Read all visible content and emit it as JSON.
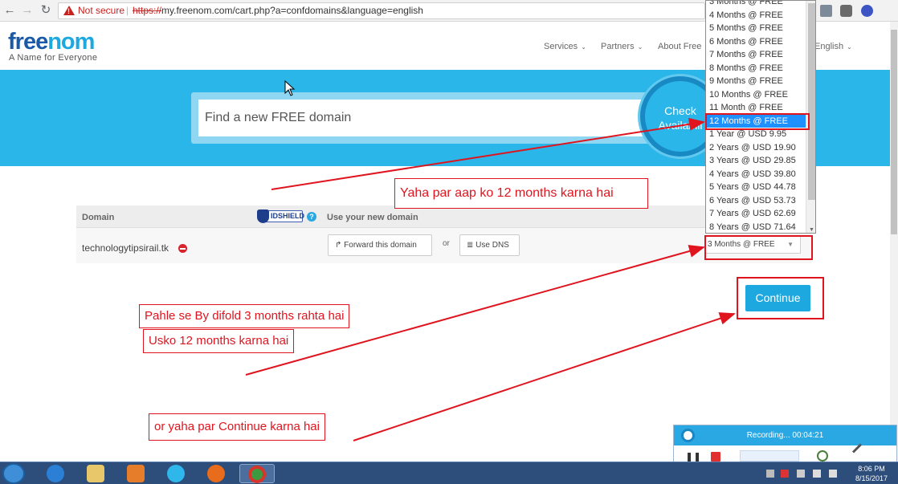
{
  "browser": {
    "back_glyph": "←",
    "forward_glyph": "→",
    "reload_glyph": "↻",
    "security_label": "Not secure",
    "url_separator": "|",
    "url_scheme": "https://",
    "url_rest": "my.freenom.com/cart.php?a=confdomains&language=english"
  },
  "site": {
    "logo_part1": "free",
    "logo_part2": "nom",
    "tagline": "A Name for Everyone",
    "nav": [
      "Services",
      "Partners",
      "About Free"
    ],
    "language": "English",
    "chevron": "⌄"
  },
  "hero": {
    "search_placeholder": "Find a new FREE domain",
    "check_line1": "Check",
    "check_line2": "Availabili"
  },
  "cart": {
    "col_domain": "Domain",
    "idshield_label": "IDSHIELD",
    "help_glyph": "?",
    "col_use": "Use your new domain",
    "domain": "technologytipsirail.tk",
    "forward_icon": "↱",
    "forward_label": "Forward this domain",
    "or_label": "or",
    "dns_icon": "≣",
    "dns_label": "Use DNS",
    "period_selected": "3 Months @ FREE",
    "select_arrow": "▼",
    "continue_label": "Continue"
  },
  "dropdown": {
    "options": [
      "3 Months @ FREE",
      "4 Months @ FREE",
      "5 Months @ FREE",
      "6 Months @ FREE",
      "7 Months @ FREE",
      "8 Months @ FREE",
      "9 Months @ FREE",
      "10 Months @ FREE",
      "11 Month @ FREE",
      "12 Months @ FREE",
      "1 Year @ USD 9.95",
      "2 Years @ USD 19.90",
      "3 Years @ USD 29.85",
      "4 Years @ USD 39.80",
      "5 Years @ USD 44.78",
      "6 Years @ USD 53.73",
      "7 Years @ USD 62.69",
      "8 Years @ USD 71.64"
    ],
    "selected_index": 9,
    "scroll_down": "▼"
  },
  "annotations": {
    "note1": "Yaha par aap ko 12 months karna hai",
    "note2": "Pahle se By difold 3 months rahta hai",
    "note3": "Usko 12 months karna hai",
    "note4": "or yaha par Continue karna hai",
    "color": "#e0141e"
  },
  "recorder": {
    "status": "Recording... 00:04:21",
    "pause_glyph": "❚❚"
  },
  "taskbar": {
    "time": "8:06 PM",
    "date": "8/15/2017"
  },
  "colors": {
    "brand_blue": "#1ea8e0",
    "brand_dark": "#1a5aa6",
    "hero_bg": "#2ab6e8",
    "selection": "#1e90ff"
  }
}
